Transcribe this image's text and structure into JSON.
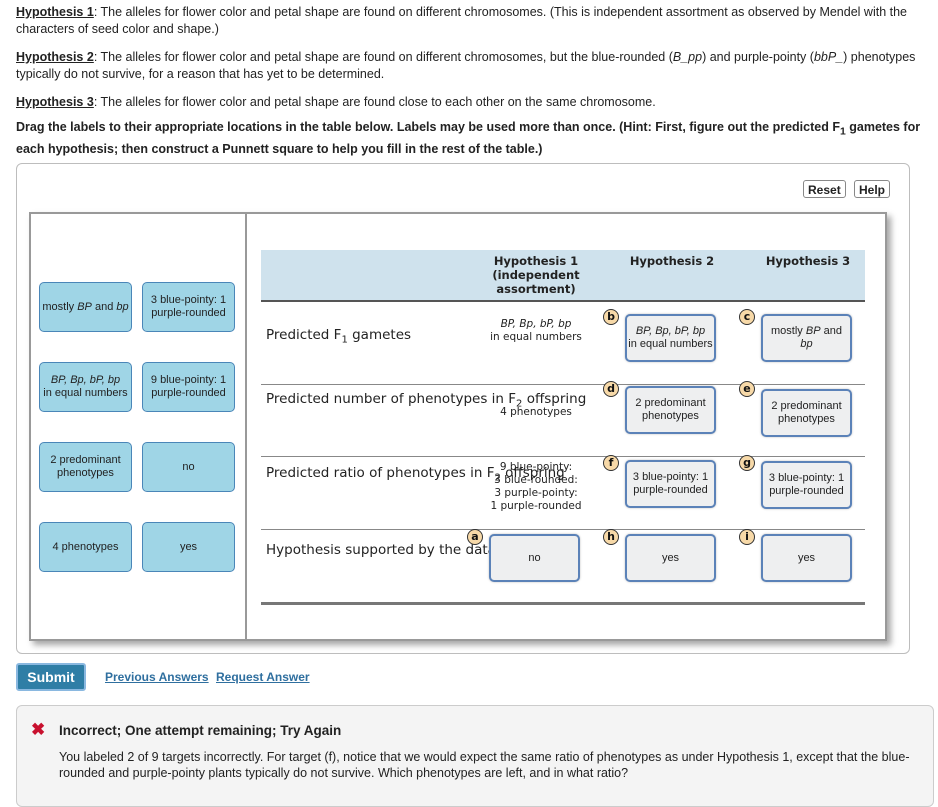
{
  "intro": {
    "h1_label": "Hypothesis 1",
    "h1_text": ": The alleles for flower color and petal shape are found on different chromosomes. (This is independent assortment as observed by Mendel with the characters of seed color and shape.)",
    "h2_label": "Hypothesis 2",
    "h2_text_a": ": The alleles for flower color and petal shape are found on different chromosomes, but the blue-rounded (",
    "h2_geno1": "B_pp",
    "h2_text_b": ") and purple-pointy (",
    "h2_geno2": "bbP_",
    "h2_text_c": ") phenotypes typically do not survive, for a reason that has yet to be determined.",
    "h3_label": "Hypothesis 3",
    "h3_text": ": The alleles for flower color and petal shape are found close to each other on the same chromosome.",
    "instructions_a": "Drag the labels to their appropriate locations in the table below. Labels may be used more than once. (Hint: First, figure out the predicted F",
    "instructions_sub": "1",
    "instructions_b": " gametes for each hypothesis; then construct a Punnett square to help you fill in the rest of the table.)"
  },
  "toolbar": {
    "reset_label": "Reset",
    "help_label": "Help"
  },
  "palette": {
    "chips": [
      {
        "pre": "mostly ",
        "italic": "BP",
        "mid": " and ",
        "italic2": "bp",
        "text": ""
      },
      {
        "text": "3 blue-pointy: 1 purple-rounded"
      },
      {
        "italic": "BP, Bp, bP, bp",
        "text": "in equal numbers"
      },
      {
        "text": "9 blue-pointy: 1 purple-rounded"
      },
      {
        "text": "2 predominant phenotypes"
      },
      {
        "text": "no"
      },
      {
        "text": "4 phenotypes"
      },
      {
        "text": "yes"
      }
    ]
  },
  "table": {
    "headers": [
      "",
      "Hypothesis 1 (independent assortment)",
      "Hypothesis 2",
      "Hypothesis 3"
    ],
    "rows": [
      {
        "label_a": "Predicted F",
        "label_sub": "1",
        "label_b": " gametes"
      },
      {
        "label_a": "Predicted number of phenotypes in F",
        "label_sub": "2",
        "label_b": " offspring"
      },
      {
        "label_a": "Predicted ratio of phenotypes in F",
        "label_sub": "2",
        "label_b": " offspring"
      },
      {
        "label_a": "Hypothesis supported by the data?",
        "label_sub": "",
        "label_b": ""
      }
    ],
    "static": {
      "gametes_h1_italic": "BP, Bp, bP, bp",
      "gametes_h1_text": "in equal numbers",
      "phenotypes_h1": "4 phenotypes",
      "ratio_h1": [
        "9 blue-pointy:",
        "3 blue-rounded:",
        "3 purple-pointy:",
        "1 purple-rounded"
      ]
    },
    "targets": {
      "a": {
        "badge": "a",
        "value": "no"
      },
      "b": {
        "badge": "b",
        "italic": "BP, Bp, bP, bp",
        "value": "in equal numbers"
      },
      "c": {
        "badge": "c",
        "pre": "mostly ",
        "italic": "BP",
        "mid": " and ",
        "italic2": "bp"
      },
      "d": {
        "badge": "d",
        "value": "2 predominant phenotypes"
      },
      "e": {
        "badge": "e",
        "value": "2 predominant phenotypes"
      },
      "f": {
        "badge": "f",
        "value": "3 blue-pointy: 1 purple-rounded"
      },
      "g": {
        "badge": "g",
        "value": "3 blue-pointy: 1 purple-rounded"
      },
      "h": {
        "badge": "h",
        "value": "yes"
      },
      "i": {
        "badge": "i",
        "value": "yes"
      }
    }
  },
  "actions": {
    "submit_label": "Submit",
    "previous_answers_label": "Previous Answers",
    "request_answer_label": "Request Answer"
  },
  "feedback": {
    "icon": "✖",
    "title": "Incorrect; One attempt remaining; Try Again",
    "message": "You labeled 2 of 9 targets incorrectly. For target (f), notice that we would expect the same ratio of phenotypes as under Hypothesis 1, except that the blue-rounded and purple-pointy plants typically do not survive. Which phenotypes are left, and in what ratio?",
    "color": "#c8102e"
  }
}
